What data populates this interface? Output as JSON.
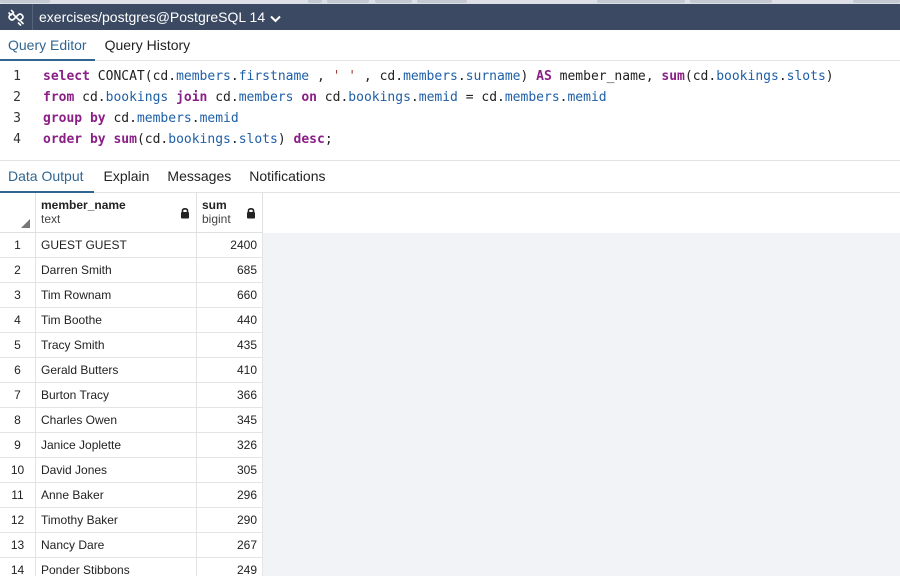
{
  "connection": {
    "title": "exercises/postgres@PostgreSQL 14"
  },
  "editor_tabs": [
    "Query Editor",
    "Query History"
  ],
  "editor_lines": [
    {
      "num": "1",
      "tokens": [
        [
          "kw",
          "select"
        ],
        [
          "txt",
          " CONCAT(cd."
        ],
        [
          "prop",
          "members"
        ],
        [
          "txt",
          "."
        ],
        [
          "prop",
          "firstname"
        ],
        [
          "txt",
          " , "
        ],
        [
          "str",
          "' '"
        ],
        [
          "txt",
          " , cd."
        ],
        [
          "prop",
          "members"
        ],
        [
          "txt",
          "."
        ],
        [
          "prop",
          "surname"
        ],
        [
          "txt",
          ") "
        ],
        [
          "kw",
          "AS"
        ],
        [
          "txt",
          " member_name, "
        ],
        [
          "kw",
          "sum"
        ],
        [
          "txt",
          "(cd."
        ],
        [
          "prop",
          "bookings"
        ],
        [
          "txt",
          "."
        ],
        [
          "prop",
          "slots"
        ],
        [
          "txt",
          ")"
        ]
      ]
    },
    {
      "num": "2",
      "tokens": [
        [
          "kw",
          "from"
        ],
        [
          "txt",
          " cd."
        ],
        [
          "prop",
          "bookings"
        ],
        [
          "txt",
          " "
        ],
        [
          "kw",
          "join"
        ],
        [
          "txt",
          " cd."
        ],
        [
          "prop",
          "members"
        ],
        [
          "txt",
          " "
        ],
        [
          "kw",
          "on"
        ],
        [
          "txt",
          " cd."
        ],
        [
          "prop",
          "bookings"
        ],
        [
          "txt",
          "."
        ],
        [
          "prop",
          "memid"
        ],
        [
          "txt",
          " = cd."
        ],
        [
          "prop",
          "members"
        ],
        [
          "txt",
          "."
        ],
        [
          "prop",
          "memid"
        ]
      ]
    },
    {
      "num": "3",
      "tokens": [
        [
          "kw",
          "group by"
        ],
        [
          "txt",
          " cd."
        ],
        [
          "prop",
          "members"
        ],
        [
          "txt",
          "."
        ],
        [
          "prop",
          "memid"
        ]
      ]
    },
    {
      "num": "4",
      "tokens": [
        [
          "kw",
          "order by"
        ],
        [
          "txt",
          " "
        ],
        [
          "kw",
          "sum"
        ],
        [
          "txt",
          "(cd."
        ],
        [
          "prop",
          "bookings"
        ],
        [
          "txt",
          "."
        ],
        [
          "prop",
          "slots"
        ],
        [
          "txt",
          ") "
        ],
        [
          "kw",
          "desc"
        ],
        [
          "txt",
          ";"
        ]
      ]
    }
  ],
  "output_tabs": [
    "Data Output",
    "Explain",
    "Messages",
    "Notifications"
  ],
  "columns": [
    {
      "name": "member_name",
      "type": "text"
    },
    {
      "name": "sum",
      "type": "bigint"
    }
  ],
  "rows": [
    {
      "n": "1",
      "member_name": "GUEST GUEST",
      "sum": "2400"
    },
    {
      "n": "2",
      "member_name": "Darren Smith",
      "sum": "685"
    },
    {
      "n": "3",
      "member_name": "Tim Rownam",
      "sum": "660"
    },
    {
      "n": "4",
      "member_name": "Tim Boothe",
      "sum": "440"
    },
    {
      "n": "5",
      "member_name": "Tracy Smith",
      "sum": "435"
    },
    {
      "n": "6",
      "member_name": "Gerald Butters",
      "sum": "410"
    },
    {
      "n": "7",
      "member_name": "Burton Tracy",
      "sum": "366"
    },
    {
      "n": "8",
      "member_name": "Charles Owen",
      "sum": "345"
    },
    {
      "n": "9",
      "member_name": "Janice Joplette",
      "sum": "326"
    },
    {
      "n": "10",
      "member_name": "David Jones",
      "sum": "305"
    },
    {
      "n": "11",
      "member_name": "Anne Baker",
      "sum": "296"
    },
    {
      "n": "12",
      "member_name": "Timothy Baker",
      "sum": "290"
    },
    {
      "n": "13",
      "member_name": "Nancy Dare",
      "sum": "267"
    },
    {
      "n": "14",
      "member_name": "Ponder Stibbons",
      "sum": "249"
    }
  ],
  "icons": {
    "connection": "plug-icon",
    "dropdown": "chevron-down-icon",
    "sort": "sort-triangle-icon",
    "column_lock": "lock-icon"
  },
  "colors": {
    "titlebar": "#3b4a62",
    "accent": "#326690",
    "keyword": "#8a1f86",
    "identifier": "#1e5fa8",
    "string": "#a13a3a"
  }
}
